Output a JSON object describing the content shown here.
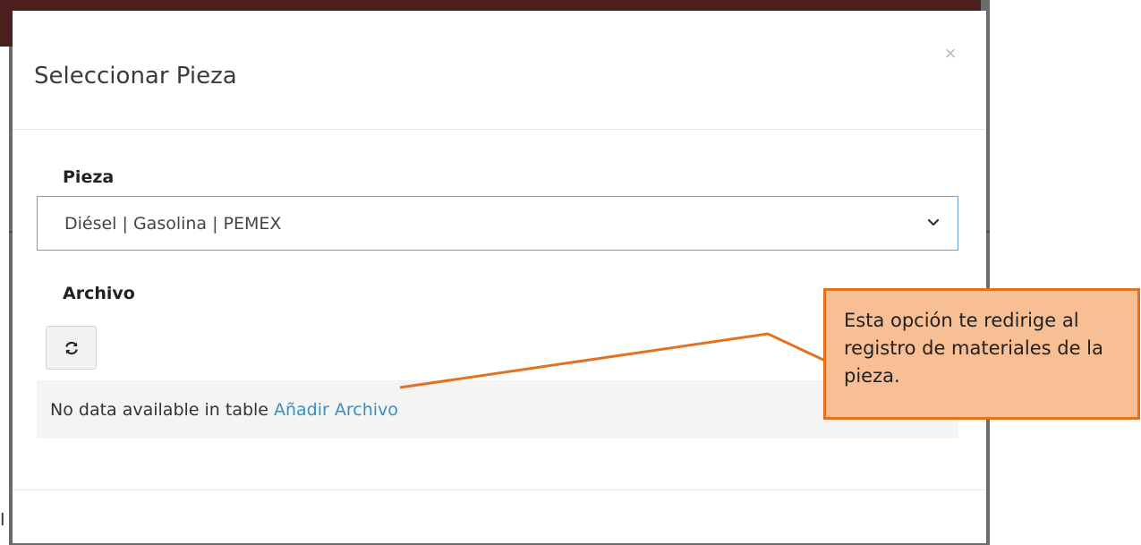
{
  "modal": {
    "title": "Seleccionar Pieza",
    "close_label": "×"
  },
  "form": {
    "pieza_label": "Pieza",
    "pieza_selected": "Diésel | Gasolina | PEMEX",
    "archivo_label": "Archivo"
  },
  "table": {
    "empty_text": "No data available in table",
    "add_link": "Añadir Archivo"
  },
  "callout": {
    "text": "Esta opción te redirige al registro de materiales de la pieza."
  },
  "backdrop": {
    "partial_letter": "I"
  },
  "colors": {
    "topbar": "#4a1f1c",
    "link": "#3c8dbc",
    "callout_fill": "#f8bf94",
    "callout_border": "#e2721f"
  },
  "icons": [
    "close-icon",
    "chevron-down-icon",
    "refresh-icon"
  ]
}
